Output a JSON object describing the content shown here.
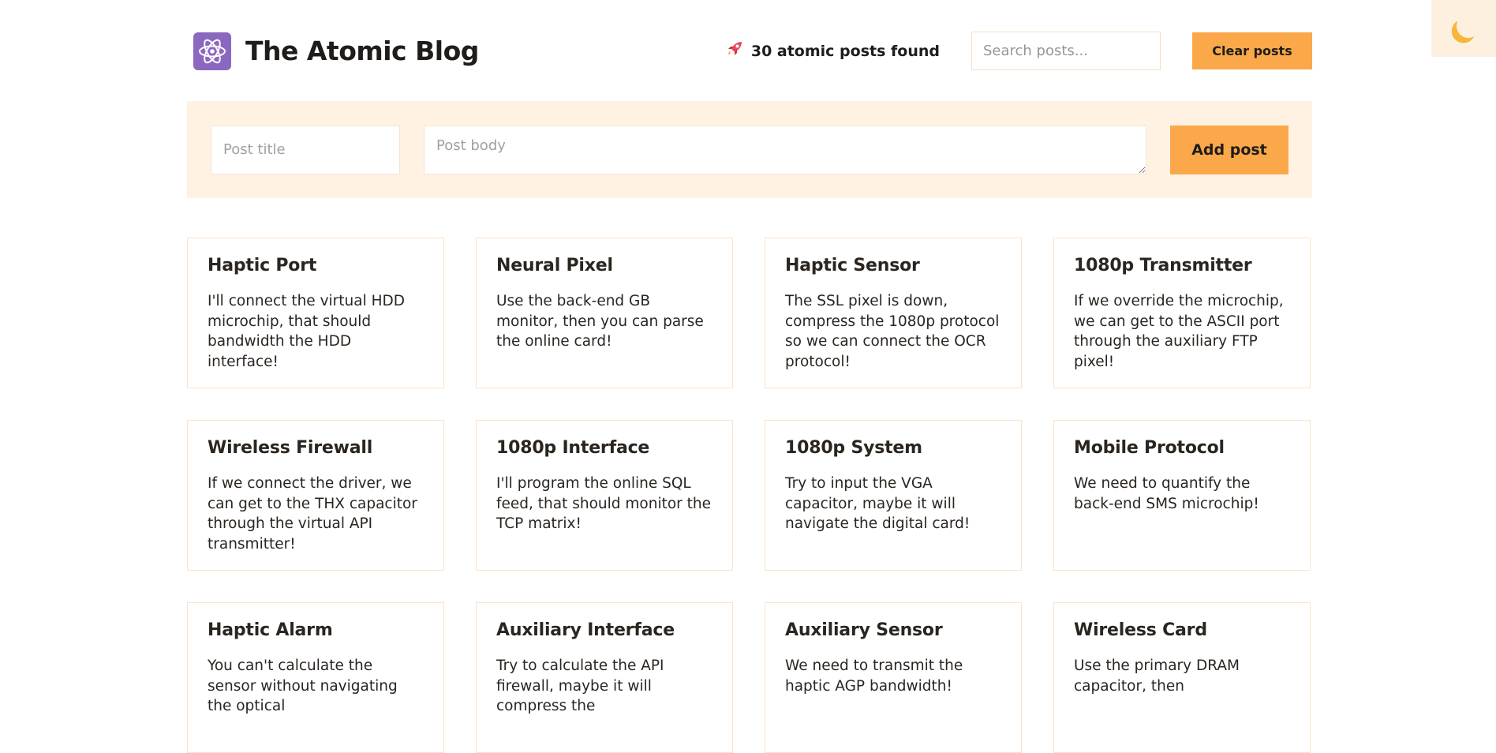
{
  "header": {
    "title": "The Atomic Blog",
    "posts_found": "30 atomic posts found",
    "search_placeholder": "Search posts...",
    "clear_label": "Clear posts",
    "logo_icon": "atom-icon",
    "rocket_icon": "rocket-icon"
  },
  "theme_toggle": {
    "icon": "moon-icon"
  },
  "form": {
    "title_placeholder": "Post title",
    "body_placeholder": "Post body",
    "add_label": "Add post"
  },
  "posts": [
    {
      "title": "Haptic Port",
      "body": "I'll connect the virtual HDD microchip, that should bandwidth the HDD interface!"
    },
    {
      "title": "Neural Pixel",
      "body": "Use the back-end GB monitor, then you can parse the online card!"
    },
    {
      "title": "Haptic Sensor",
      "body": "The SSL pixel is down, compress the 1080p protocol so we can connect the OCR protocol!"
    },
    {
      "title": "1080p Transmitter",
      "body": "If we override the microchip, we can get to the ASCII port through the auxiliary FTP pixel!"
    },
    {
      "title": "Wireless Firewall",
      "body": "If we connect the driver, we can get to the THX capacitor through the virtual API transmitter!"
    },
    {
      "title": "1080p Interface",
      "body": "I'll program the online SQL feed, that should monitor the TCP matrix!"
    },
    {
      "title": "1080p System",
      "body": "Try to input the VGA capacitor, maybe it will navigate the digital card!"
    },
    {
      "title": "Mobile Protocol",
      "body": "We need to quantify the back-end SMS microchip!"
    },
    {
      "title": "Haptic Alarm",
      "body": "You can't calculate the sensor without navigating the optical"
    },
    {
      "title": "Auxiliary Interface",
      "body": "Try to calculate the API firewall, maybe it will compress the"
    },
    {
      "title": "Auxiliary Sensor",
      "body": "We need to transmit the haptic AGP bandwidth!"
    },
    {
      "title": "Wireless Card",
      "body": "Use the primary DRAM capacitor, then"
    }
  ],
  "colors": {
    "accent": "#fba84a",
    "form_bg": "#fff2e3",
    "card_border": "#fbe3c8",
    "logo_bg": "#8b67c0"
  }
}
